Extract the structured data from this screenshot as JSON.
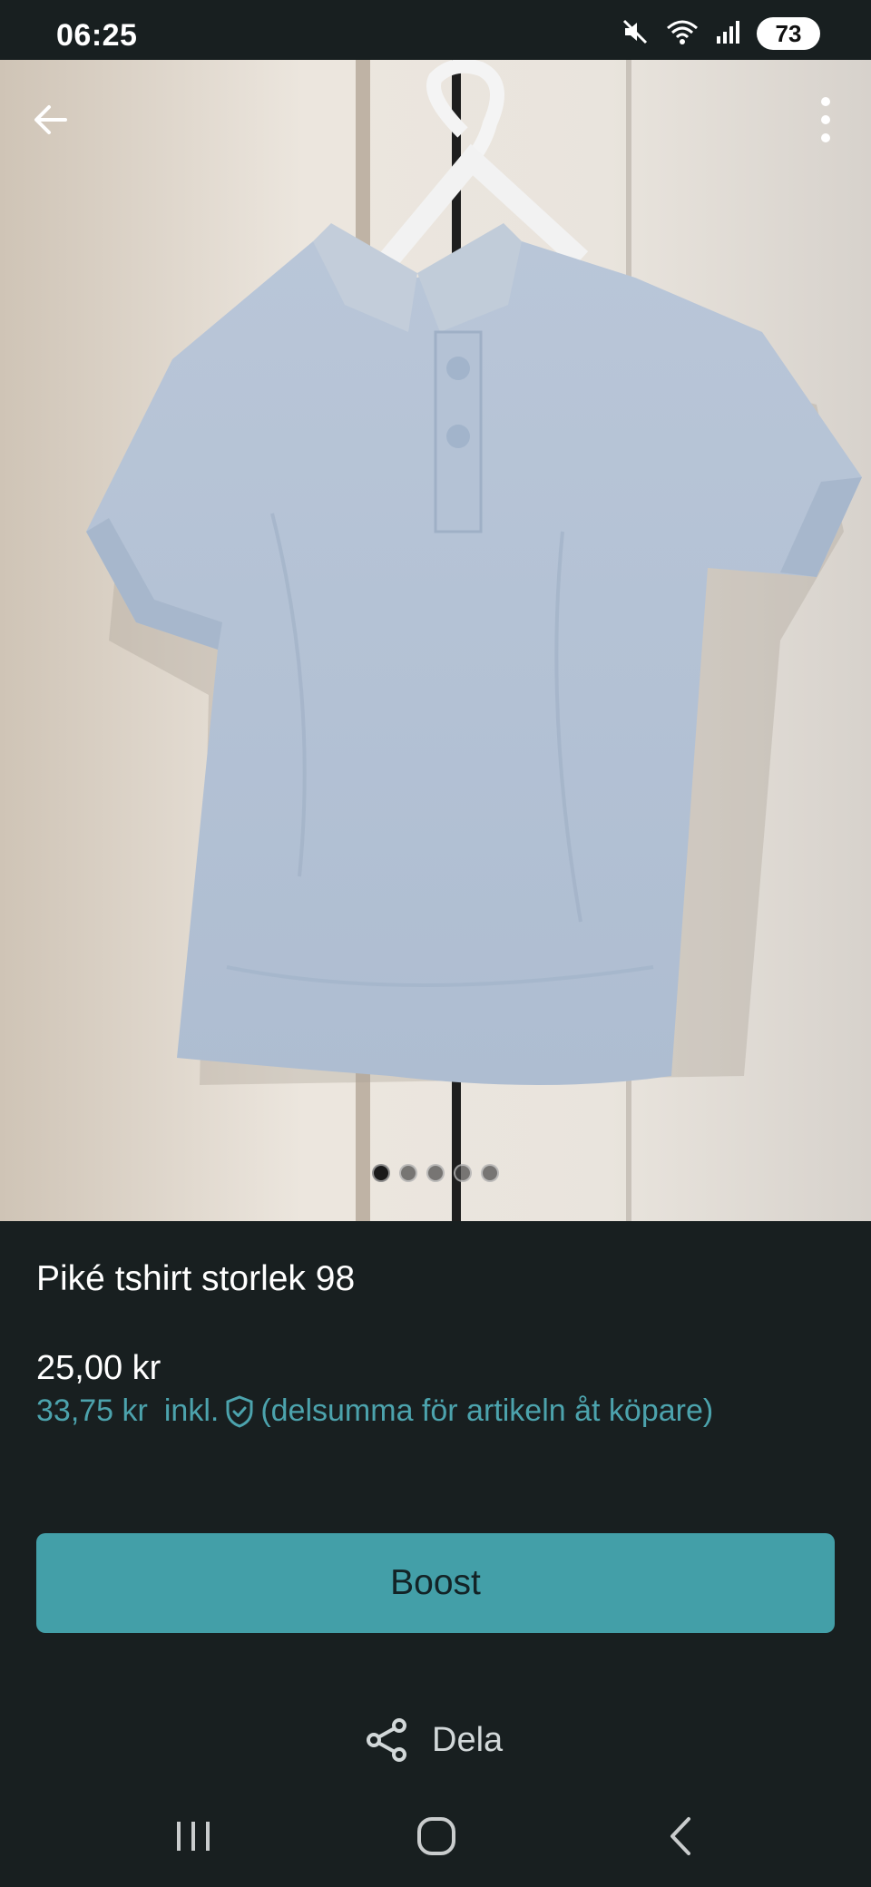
{
  "status_bar": {
    "time": "06:25",
    "battery": "73",
    "icons": [
      "mute-icon",
      "wifi-icon",
      "signal-icon",
      "battery-icon"
    ]
  },
  "listing": {
    "image_count": 5,
    "active_image": 1,
    "title": "Piké tshirt storlek 98",
    "price": "25,00 kr",
    "buyer_price": "33,75 kr",
    "buyer_price_incl": "inkl.",
    "buyer_price_note": "(delsumma för artikeln åt köpare)"
  },
  "actions": {
    "boost_label": "Boost",
    "share_label": "Dela"
  },
  "colors": {
    "background": "#181f20",
    "accent": "#439fa8",
    "accent_text": "#4ca3ad"
  }
}
